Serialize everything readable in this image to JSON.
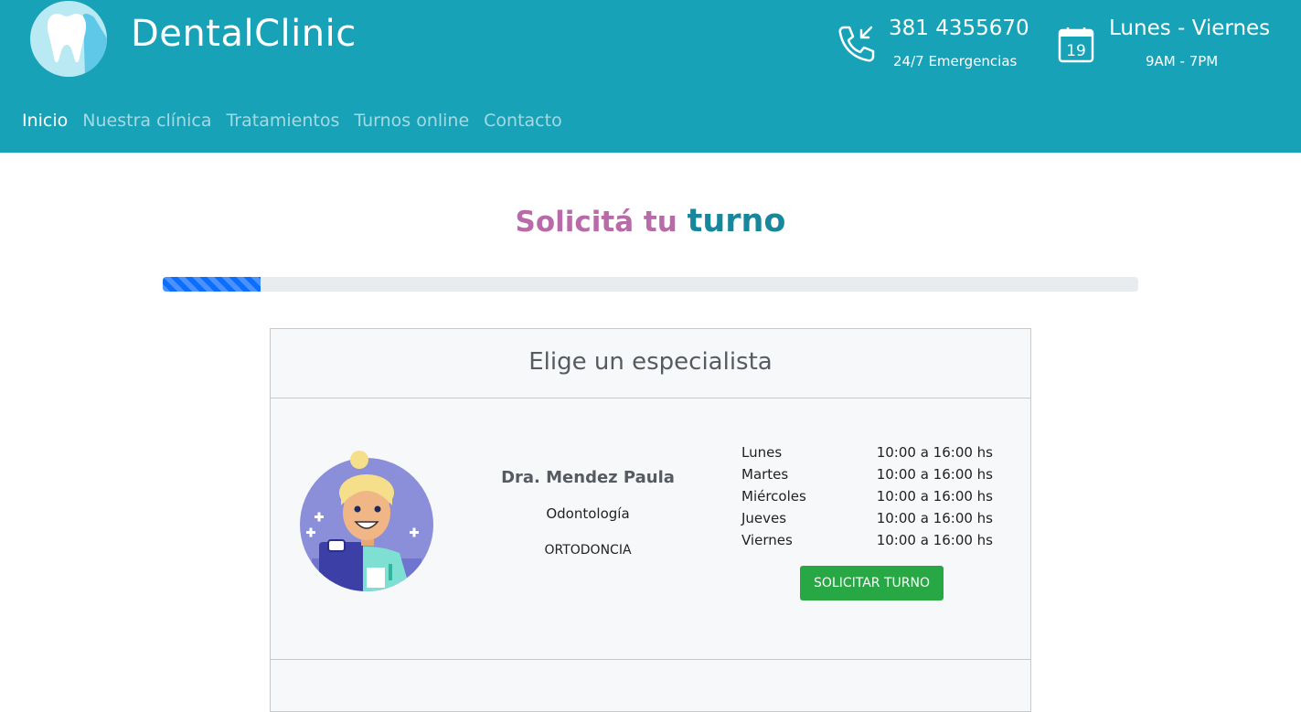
{
  "brand": {
    "name": "DentalClinic"
  },
  "contact": {
    "phone": "381 4355670",
    "phone_sub": "24/7 Emergencias",
    "days": "Lunes - Viernes",
    "hours": "9AM - 7PM",
    "calendar_day": "19"
  },
  "nav": {
    "items": [
      {
        "label": "Inicio",
        "active": true
      },
      {
        "label": "Nuestra clínica",
        "active": false
      },
      {
        "label": "Tratamientos",
        "active": false
      },
      {
        "label": "Turnos online",
        "active": false
      },
      {
        "label": "Contacto",
        "active": false
      }
    ]
  },
  "page": {
    "title_part1": "Solicitá tu",
    "title_part2": "turno"
  },
  "progress": {
    "value_percent": 10
  },
  "card": {
    "header": "Elige un especialista",
    "doctor": {
      "name": "Dra. Mendez Paula",
      "specialty": "Odontología",
      "subspecialty": "ORTODONCIA",
      "schedule": [
        {
          "day": "Lunes",
          "hours": "10:00 a 16:00 hs"
        },
        {
          "day": "Martes",
          "hours": "10:00 a 16:00 hs"
        },
        {
          "day": "Miércoles",
          "hours": "10:00 a 16:00 hs"
        },
        {
          "day": "Jueves",
          "hours": "10:00 a 16:00 hs"
        },
        {
          "day": "Viernes",
          "hours": "10:00 a 16:00 hs"
        }
      ],
      "button_label": "SOLICITAR TURNO"
    }
  },
  "icons": {
    "logo": "tooth-icon",
    "phone": "phone-incoming-icon",
    "calendar": "calendar-icon",
    "avatar": "doctor-avatar"
  },
  "colors": {
    "header_bg": "#17a2b8",
    "title_accent": "#b86ba8",
    "title_strong": "#17889c",
    "button": "#28a745",
    "progress": "#0d6efd"
  }
}
